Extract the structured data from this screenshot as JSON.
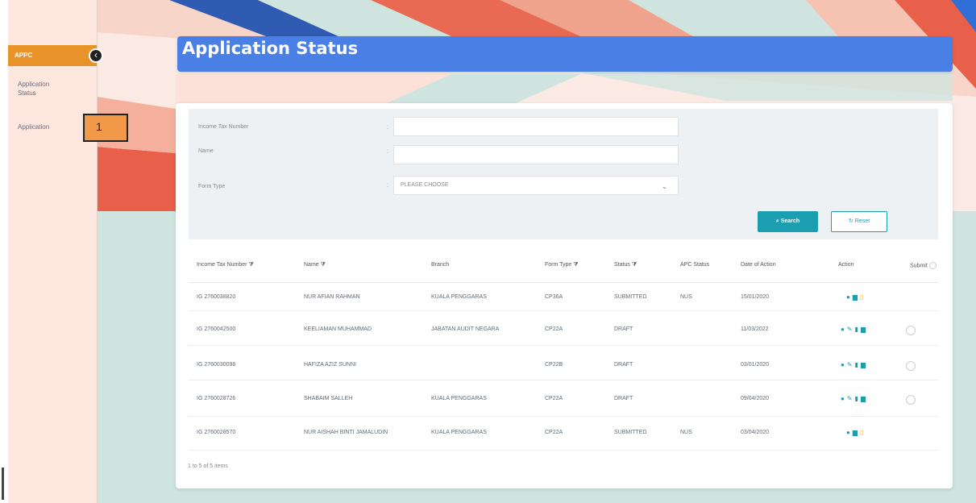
{
  "sidebar": {
    "header_label": "APPC",
    "items": [
      {
        "label_line1": "Application",
        "label_line2": "Status"
      },
      {
        "label": "Application"
      }
    ]
  },
  "callout": {
    "label": "1"
  },
  "page": {
    "title": "Application Status"
  },
  "filters": {
    "fields": [
      {
        "label": "Income Tax Number",
        "value": ""
      },
      {
        "label": "Name",
        "value": ""
      },
      {
        "label": "Form Type",
        "value": "PLEASE CHOOSE"
      }
    ],
    "search_label": "Search",
    "reset_label": "Reset"
  },
  "table": {
    "columns": [
      "Income Tax Number",
      "Name",
      "Branch",
      "Form Type",
      "Status",
      "APC Status",
      "Date of Action",
      "Action",
      "Submit"
    ],
    "rows": [
      {
        "tax": "IG 2760038820",
        "name": "NUR AFIAN RAHMAN",
        "branch": "KUALA PENGGARAS",
        "form": "CP36A",
        "status": "SUBMITTED",
        "apc": "NUS",
        "date": "15/01/2020",
        "actions": [
          "eye",
          "print",
          "file"
        ],
        "submit": false
      },
      {
        "tax": "IG 2760042500",
        "name": "KEELIAMAN MUHAMMAD",
        "branch": "JABATAN AUDIT NEGARA",
        "form": "CP22A",
        "status": "DRAFT",
        "apc": "",
        "date": "11/03/2022",
        "actions": [
          "eye",
          "edit",
          "delete",
          "print"
        ],
        "submit": true
      },
      {
        "tax": "IG 2760030098",
        "name": "HAFIZA AZIZ SUNNI",
        "branch": "",
        "form": "CP22B",
        "status": "DRAFT",
        "apc": "",
        "date": "03/01/2020",
        "actions": [
          "eye",
          "edit",
          "delete",
          "print"
        ],
        "submit": true
      },
      {
        "tax": "IG 2760028726",
        "name": "SHABAIM SALLEH",
        "branch": "KUALA PENGGARAS",
        "form": "CP22A",
        "status": "DRAFT",
        "apc": "",
        "date": "09/04/2020",
        "actions": [
          "eye",
          "edit",
          "delete",
          "print"
        ],
        "submit": true
      },
      {
        "tax": "IG 2760028570",
        "name": "NUR AISHAH BINTI JAMALUDIN",
        "branch": "KUALA PENGGARAS",
        "form": "CP22A",
        "status": "SUBMITTED",
        "apc": "NUS",
        "date": "03/04/2020",
        "actions": [
          "eye",
          "print",
          "file"
        ],
        "submit": false
      }
    ],
    "footer": "1 to 5 of 5 items"
  }
}
